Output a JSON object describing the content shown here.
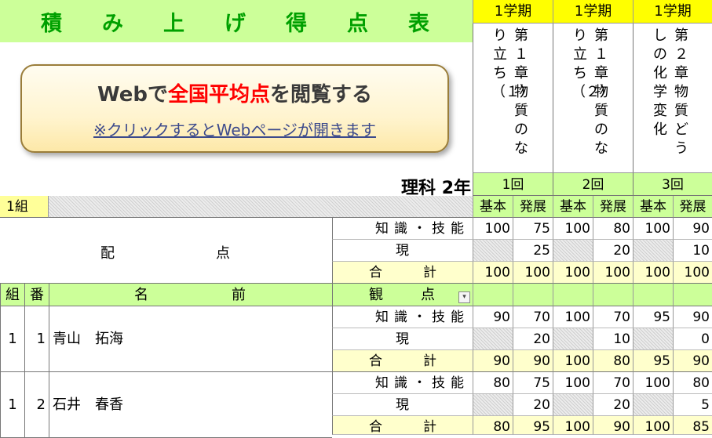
{
  "title": {
    "chars": [
      "積",
      "み",
      "上",
      "げ",
      "得",
      "点",
      "表"
    ]
  },
  "web_button": {
    "main_prefix": "Webで",
    "main_red": "全国平均点",
    "main_suffix": "を閲覧する",
    "sub": "※クリックするとWebページが開きます"
  },
  "subject": "理科 2年",
  "units": [
    {
      "term": "1学期",
      "lines": [
        "第１章　物質のな",
        "り立ち（１）"
      ],
      "round": "1回"
    },
    {
      "term": "1学期",
      "lines": [
        "第１章　物質のな",
        "り立ち（２）"
      ],
      "round": "2回"
    },
    {
      "term": "1学期",
      "lines": [
        "第２章　物質どう",
        "しの化学変化"
      ],
      "round": "3回"
    }
  ],
  "class_label": "1組",
  "sub_headers": [
    "基本",
    "発展",
    "基本",
    "発展",
    "基本",
    "発展"
  ],
  "haiten": {
    "label_a": "配",
    "label_b": "点",
    "rows": [
      {
        "label": "知識・技能",
        "values": [
          "100",
          "75",
          "100",
          "80",
          "100",
          "90"
        ]
      },
      {
        "label": "現",
        "values": [
          "",
          "25",
          "",
          "20",
          "",
          "10"
        ]
      },
      {
        "label_a": "合",
        "label_b": "計",
        "values": [
          "100",
          "100",
          "100",
          "100",
          "100",
          "100"
        ]
      }
    ]
  },
  "columns": {
    "kumi": "組",
    "ban": "番",
    "name_a": "名",
    "name_b": "前",
    "kanten_a": "観",
    "kanten_b": "点"
  },
  "students": [
    {
      "kumi": "1",
      "ban": "1",
      "name": "青山　拓海",
      "rows": [
        {
          "label": "知識・技能",
          "values": [
            "90",
            "70",
            "100",
            "70",
            "95",
            "90"
          ]
        },
        {
          "label": "現",
          "values": [
            "",
            "20",
            "",
            "10",
            "",
            "0"
          ]
        },
        {
          "label_a": "合",
          "label_b": "計",
          "values": [
            "90",
            "90",
            "100",
            "80",
            "95",
            "90"
          ]
        }
      ]
    },
    {
      "kumi": "1",
      "ban": "2",
      "name": "石井　春香",
      "rows": [
        {
          "label": "知識・技能",
          "values": [
            "80",
            "75",
            "100",
            "70",
            "100",
            "80"
          ]
        },
        {
          "label": "現",
          "values": [
            "",
            "20",
            "",
            "20",
            "",
            "5"
          ]
        },
        {
          "label_a": "合",
          "label_b": "計",
          "values": [
            "80",
            "95",
            "100",
            "90",
            "100",
            "85"
          ]
        }
      ]
    }
  ],
  "dropdown_icon": "▾"
}
